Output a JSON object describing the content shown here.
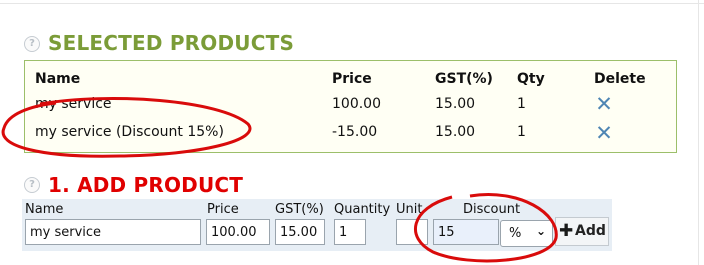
{
  "selected_products": {
    "title": "SELECTED PRODUCTS",
    "headers": {
      "name": "Name",
      "price": "Price",
      "gst": "GST(%)",
      "qty": "Qty",
      "delete": "Delete"
    },
    "rows": [
      {
        "name": "my service",
        "price": "100.00",
        "gst": "15.00",
        "qty": "1"
      },
      {
        "name": "my service (Discount 15%)",
        "price": "-15.00",
        "gst": "15.00",
        "qty": "1"
      }
    ]
  },
  "add_product": {
    "title": "1. ADD PRODUCT",
    "labels": {
      "name": "Name",
      "price": "Price",
      "gst": "GST(%)",
      "quantity": "Quantity",
      "unit": "Unit",
      "discount": "Discount"
    },
    "values": {
      "name": "my service",
      "price": "100.00",
      "gst": "15.00",
      "quantity": "1",
      "unit": "",
      "discount": "15"
    },
    "discount_type": "%",
    "add_label": "Add"
  },
  "icons": {
    "help": "help-circle-icon",
    "delete": "delete-x-icon",
    "plus": "plus-icon"
  },
  "colors": {
    "section_green": "#7b9c38",
    "section_red": "#e00000",
    "annotation_red": "#d90b0b",
    "delete_blue": "#4f86b4",
    "box_border": "#9cbf6a"
  }
}
